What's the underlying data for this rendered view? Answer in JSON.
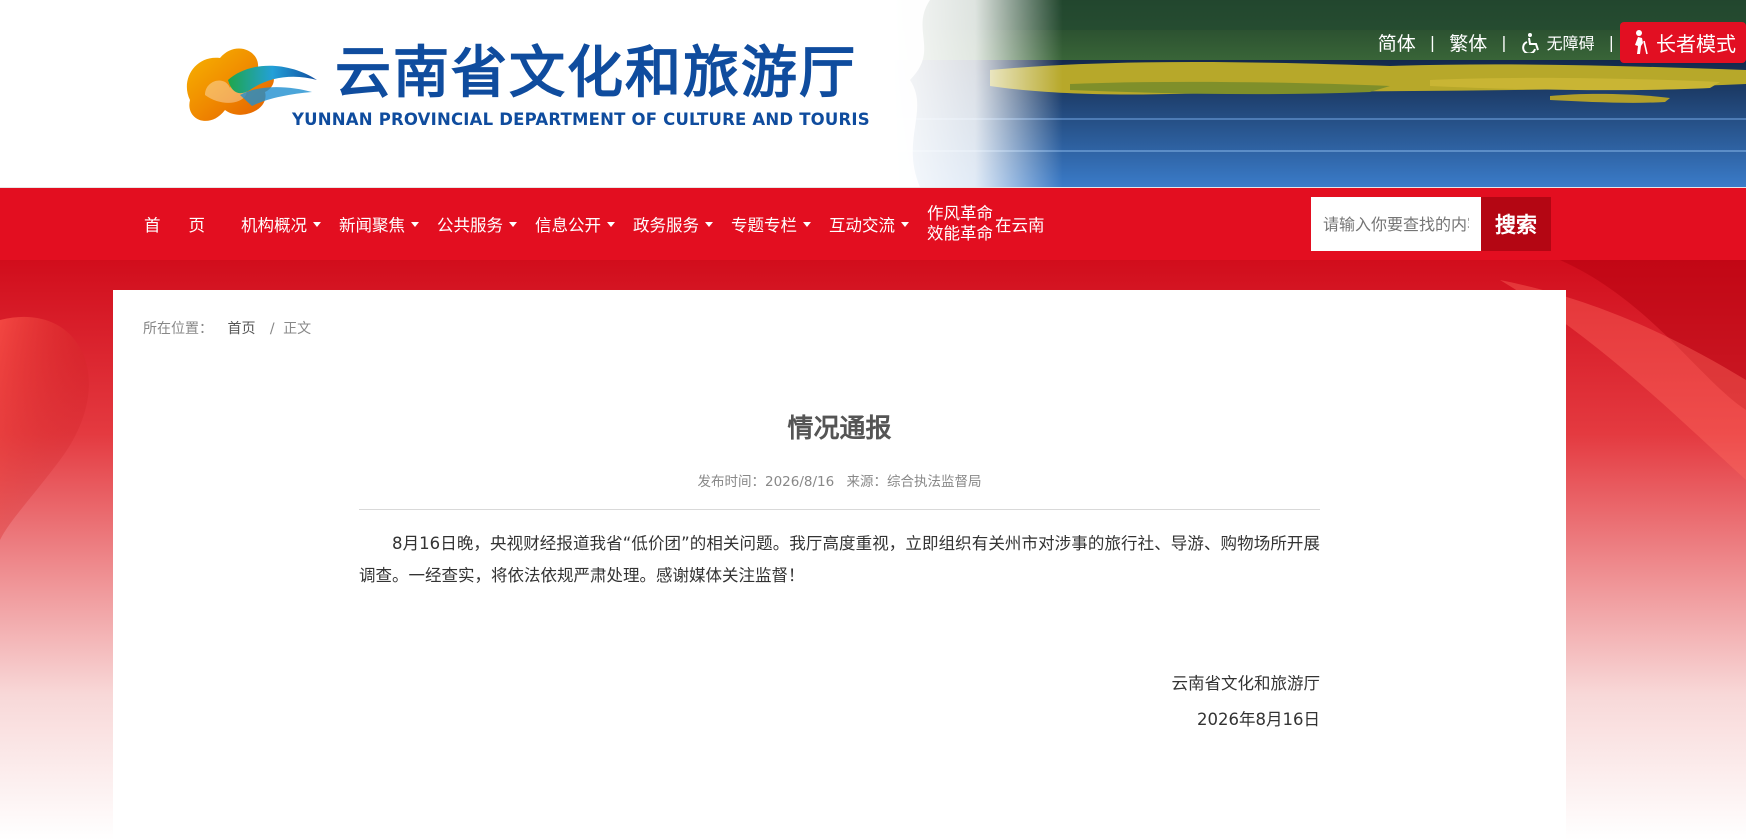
{
  "header": {
    "logo_cn": "云南省文化和旅游厅",
    "logo_en": "YUNNAN PROVINCIAL DEPARTMENT OF CULTURE AND TOURISM",
    "links": {
      "simplified": "简体",
      "traditional": "繁体",
      "separator": "|",
      "accessibility": "无障碍",
      "elder_mode": "长者模式"
    }
  },
  "nav": {
    "home": "首页",
    "items": [
      {
        "label": "机构概况"
      },
      {
        "label": "新闻聚焦"
      },
      {
        "label": "公共服务"
      },
      {
        "label": "信息公开"
      },
      {
        "label": "政务服务"
      },
      {
        "label": "专题专栏"
      },
      {
        "label": "互动交流"
      }
    ],
    "zuofeng_line1": "作风革命",
    "zuofeng_line2": "效能革命",
    "zai_yunnan": "在云南",
    "search_placeholder": "请输入你要查找的内容",
    "search_button": "搜索"
  },
  "breadcrumb": {
    "label": "所在位置：",
    "home": "首页",
    "separator": "/",
    "current": "正文"
  },
  "article": {
    "title": "情况通报",
    "publish_time": "发布时间：2026/8/16",
    "source": "来源：综合执法监督局",
    "body": "8月16日晚，央视财经报道我省“低价团”的相关问题。我厅高度重视，立即组织有关州市对涉事的旅行社、导游、购物场所开展调查。一经查实，将依法依规严肃处理。感谢媒体关注监督！",
    "signature_org": "云南省文化和旅游厅",
    "signature_date": "2026年8月16日"
  },
  "colors": {
    "nav_red": "#e30e20",
    "search_button": "#b40613",
    "logo_blue": "#0f4c9e"
  }
}
